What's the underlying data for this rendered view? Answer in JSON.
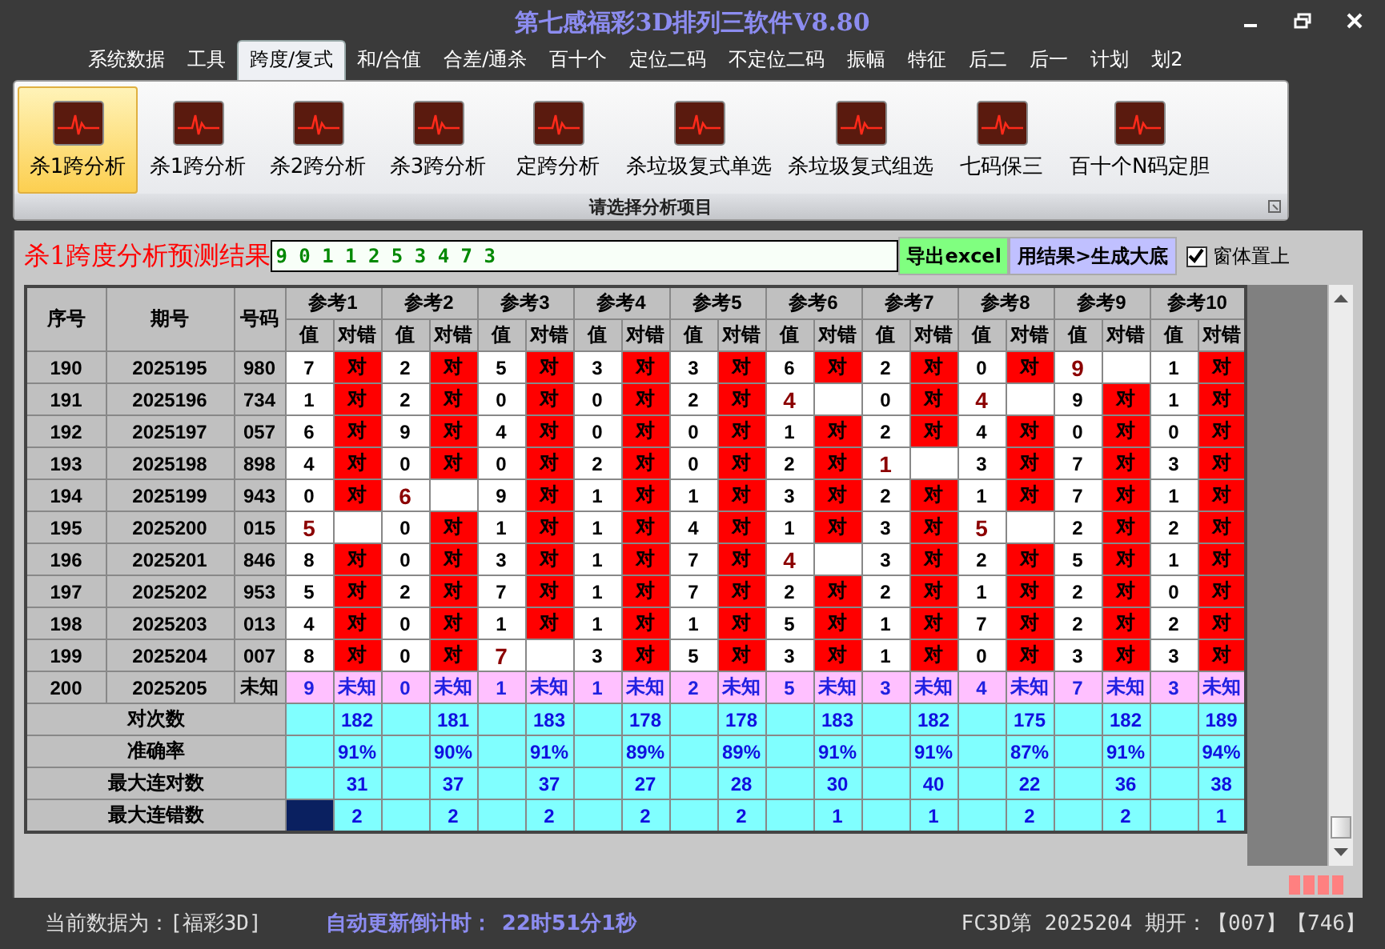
{
  "window": {
    "title": "第七感福彩3D排列三软件V8.80"
  },
  "menu_tabs": [
    {
      "label": "系统数据",
      "selected": false
    },
    {
      "label": "工具",
      "selected": false
    },
    {
      "label": "跨度/复式",
      "selected": true
    },
    {
      "label": "和/合值",
      "selected": false
    },
    {
      "label": "合差/通杀",
      "selected": false
    },
    {
      "label": "百十个",
      "selected": false
    },
    {
      "label": "定位二码",
      "selected": false
    },
    {
      "label": "不定位二码",
      "selected": false
    },
    {
      "label": "振幅",
      "selected": false
    },
    {
      "label": "特征",
      "selected": false
    },
    {
      "label": "后二",
      "selected": false
    },
    {
      "label": "后一",
      "selected": false
    },
    {
      "label": "计划",
      "selected": false
    },
    {
      "label": "划2",
      "selected": false
    }
  ],
  "ribbon": {
    "group_label": "请选择分析项目",
    "buttons": [
      {
        "label": "杀1跨分析",
        "selected": true
      },
      {
        "label": "杀1跨分析",
        "selected": false
      },
      {
        "label": "杀2跨分析",
        "selected": false
      },
      {
        "label": "杀3跨分析",
        "selected": false
      },
      {
        "label": "定跨分析",
        "selected": false
      },
      {
        "label": "杀垃圾复式单选",
        "selected": false
      },
      {
        "label": "杀垃圾复式组选",
        "selected": false
      },
      {
        "label": "七码保三",
        "selected": false
      },
      {
        "label": "百十个N码定胆",
        "selected": false
      }
    ]
  },
  "result_title": "杀1跨度分析预测结果",
  "result_value": "9 0 1 1 2 5 3 4 7 3",
  "export_button": "导出excel",
  "generate_button": "用结果>生成大底",
  "stay_on_top": {
    "label": "窗体置上",
    "checked": true
  },
  "table": {
    "columns": [
      "序号",
      "期号",
      "号码"
    ],
    "groups": [
      {
        "label": "参考1",
        "sub_columns": [
          "值",
          "对错"
        ]
      },
      {
        "label": "参考2",
        "sub_columns": [
          "值",
          "对错"
        ]
      },
      {
        "label": "参考3",
        "sub_columns": [
          "值",
          "对错"
        ]
      },
      {
        "label": "参考4",
        "sub_columns": [
          "值",
          "对错"
        ]
      },
      {
        "label": "参考5",
        "sub_columns": [
          "值",
          "对错"
        ]
      },
      {
        "label": "参考6",
        "sub_columns": [
          "值",
          "对错"
        ]
      },
      {
        "label": "参考7",
        "sub_columns": [
          "值",
          "对错"
        ]
      },
      {
        "label": "参考8",
        "sub_columns": [
          "值",
          "对错"
        ]
      },
      {
        "label": "参考9",
        "sub_columns": [
          "值",
          "对错"
        ]
      },
      {
        "label": "参考10",
        "sub_columns": [
          "值",
          "对错"
        ]
      }
    ],
    "rows": [
      {
        "kind": "history",
        "no": "190",
        "issue": "2025195",
        "code": "980",
        "cells": [
          {
            "v": "7",
            "ok": true,
            "mark": "对"
          },
          {
            "v": "2",
            "ok": true,
            "mark": "对"
          },
          {
            "v": "5",
            "ok": true,
            "mark": "对"
          },
          {
            "v": "3",
            "ok": true,
            "mark": "对"
          },
          {
            "v": "3",
            "ok": true,
            "mark": "对"
          },
          {
            "v": "6",
            "ok": true,
            "mark": "对"
          },
          {
            "v": "2",
            "ok": true,
            "mark": "对"
          },
          {
            "v": "0",
            "ok": true,
            "mark": "对"
          },
          {
            "v": "9",
            "ok": false
          },
          {
            "v": "1",
            "ok": true,
            "mark": "对"
          }
        ]
      },
      {
        "kind": "history",
        "no": "191",
        "issue": "2025196",
        "code": "734",
        "cells": [
          {
            "v": "1",
            "ok": true,
            "mark": "对"
          },
          {
            "v": "2",
            "ok": true,
            "mark": "对"
          },
          {
            "v": "0",
            "ok": true,
            "mark": "对"
          },
          {
            "v": "0",
            "ok": true,
            "mark": "对"
          },
          {
            "v": "2",
            "ok": true,
            "mark": "对"
          },
          {
            "v": "4",
            "ok": false
          },
          {
            "v": "0",
            "ok": true,
            "mark": "对"
          },
          {
            "v": "4",
            "ok": false
          },
          {
            "v": "9",
            "ok": true,
            "mark": "对"
          },
          {
            "v": "1",
            "ok": true,
            "mark": "对"
          }
        ]
      },
      {
        "kind": "history",
        "no": "192",
        "issue": "2025197",
        "code": "057",
        "cells": [
          {
            "v": "6",
            "ok": true,
            "mark": "对"
          },
          {
            "v": "9",
            "ok": true,
            "mark": "对"
          },
          {
            "v": "4",
            "ok": true,
            "mark": "对"
          },
          {
            "v": "0",
            "ok": true,
            "mark": "对"
          },
          {
            "v": "0",
            "ok": true,
            "mark": "对"
          },
          {
            "v": "1",
            "ok": true,
            "mark": "对"
          },
          {
            "v": "2",
            "ok": true,
            "mark": "对"
          },
          {
            "v": "4",
            "ok": true,
            "mark": "对"
          },
          {
            "v": "0",
            "ok": true,
            "mark": "对"
          },
          {
            "v": "0",
            "ok": true,
            "mark": "对"
          }
        ]
      },
      {
        "kind": "history",
        "no": "193",
        "issue": "2025198",
        "code": "898",
        "cells": [
          {
            "v": "4",
            "ok": true,
            "mark": "对"
          },
          {
            "v": "0",
            "ok": true,
            "mark": "对"
          },
          {
            "v": "0",
            "ok": true,
            "mark": "对"
          },
          {
            "v": "2",
            "ok": true,
            "mark": "对"
          },
          {
            "v": "0",
            "ok": true,
            "mark": "对"
          },
          {
            "v": "2",
            "ok": true,
            "mark": "对"
          },
          {
            "v": "1",
            "ok": false
          },
          {
            "v": "3",
            "ok": true,
            "mark": "对"
          },
          {
            "v": "7",
            "ok": true,
            "mark": "对"
          },
          {
            "v": "3",
            "ok": true,
            "mark": "对"
          }
        ]
      },
      {
        "kind": "history",
        "no": "194",
        "issue": "2025199",
        "code": "943",
        "cells": [
          {
            "v": "0",
            "ok": true,
            "mark": "对"
          },
          {
            "v": "6",
            "ok": false
          },
          {
            "v": "9",
            "ok": true,
            "mark": "对"
          },
          {
            "v": "1",
            "ok": true,
            "mark": "对"
          },
          {
            "v": "1",
            "ok": true,
            "mark": "对"
          },
          {
            "v": "3",
            "ok": true,
            "mark": "对"
          },
          {
            "v": "2",
            "ok": true,
            "mark": "对"
          },
          {
            "v": "1",
            "ok": true,
            "mark": "对"
          },
          {
            "v": "7",
            "ok": true,
            "mark": "对"
          },
          {
            "v": "1",
            "ok": true,
            "mark": "对"
          }
        ]
      },
      {
        "kind": "history",
        "no": "195",
        "issue": "2025200",
        "code": "015",
        "cells": [
          {
            "v": "5",
            "ok": false
          },
          {
            "v": "0",
            "ok": true,
            "mark": "对"
          },
          {
            "v": "1",
            "ok": true,
            "mark": "对"
          },
          {
            "v": "1",
            "ok": true,
            "mark": "对"
          },
          {
            "v": "4",
            "ok": true,
            "mark": "对"
          },
          {
            "v": "1",
            "ok": true,
            "mark": "对"
          },
          {
            "v": "3",
            "ok": true,
            "mark": "对"
          },
          {
            "v": "5",
            "ok": false
          },
          {
            "v": "2",
            "ok": true,
            "mark": "对"
          },
          {
            "v": "2",
            "ok": true,
            "mark": "对"
          }
        ]
      },
      {
        "kind": "history",
        "no": "196",
        "issue": "2025201",
        "code": "846",
        "cells": [
          {
            "v": "8",
            "ok": true,
            "mark": "对"
          },
          {
            "v": "0",
            "ok": true,
            "mark": "对"
          },
          {
            "v": "3",
            "ok": true,
            "mark": "对"
          },
          {
            "v": "1",
            "ok": true,
            "mark": "对"
          },
          {
            "v": "7",
            "ok": true,
            "mark": "对"
          },
          {
            "v": "4",
            "ok": false
          },
          {
            "v": "3",
            "ok": true,
            "mark": "对"
          },
          {
            "v": "2",
            "ok": true,
            "mark": "对"
          },
          {
            "v": "5",
            "ok": true,
            "mark": "对"
          },
          {
            "v": "1",
            "ok": true,
            "mark": "对"
          }
        ]
      },
      {
        "kind": "history",
        "no": "197",
        "issue": "2025202",
        "code": "953",
        "cells": [
          {
            "v": "5",
            "ok": true,
            "mark": "对"
          },
          {
            "v": "2",
            "ok": true,
            "mark": "对"
          },
          {
            "v": "7",
            "ok": true,
            "mark": "对"
          },
          {
            "v": "1",
            "ok": true,
            "mark": "对"
          },
          {
            "v": "7",
            "ok": true,
            "mark": "对"
          },
          {
            "v": "2",
            "ok": true,
            "mark": "对"
          },
          {
            "v": "2",
            "ok": true,
            "mark": "对"
          },
          {
            "v": "1",
            "ok": true,
            "mark": "对"
          },
          {
            "v": "2",
            "ok": true,
            "mark": "对"
          },
          {
            "v": "0",
            "ok": true,
            "mark": "对"
          }
        ]
      },
      {
        "kind": "history",
        "no": "198",
        "issue": "2025203",
        "code": "013",
        "cells": [
          {
            "v": "4",
            "ok": true,
            "mark": "对"
          },
          {
            "v": "0",
            "ok": true,
            "mark": "对"
          },
          {
            "v": "1",
            "ok": true,
            "mark": "对"
          },
          {
            "v": "1",
            "ok": true,
            "mark": "对"
          },
          {
            "v": "1",
            "ok": true,
            "mark": "对"
          },
          {
            "v": "5",
            "ok": true,
            "mark": "对"
          },
          {
            "v": "1",
            "ok": true,
            "mark": "对"
          },
          {
            "v": "7",
            "ok": true,
            "mark": "对"
          },
          {
            "v": "2",
            "ok": true,
            "mark": "对"
          },
          {
            "v": "2",
            "ok": true,
            "mark": "对"
          }
        ]
      },
      {
        "kind": "history",
        "no": "199",
        "issue": "2025204",
        "code": "007",
        "cells": [
          {
            "v": "8",
            "ok": true,
            "mark": "对"
          },
          {
            "v": "0",
            "ok": true,
            "mark": "对"
          },
          {
            "v": "7",
            "ok": false
          },
          {
            "v": "3",
            "ok": true,
            "mark": "对"
          },
          {
            "v": "5",
            "ok": true,
            "mark": "对"
          },
          {
            "v": "3",
            "ok": true,
            "mark": "对"
          },
          {
            "v": "1",
            "ok": true,
            "mark": "对"
          },
          {
            "v": "0",
            "ok": true,
            "mark": "对"
          },
          {
            "v": "3",
            "ok": true,
            "mark": "对"
          },
          {
            "v": "3",
            "ok": true,
            "mark": "对"
          }
        ]
      },
      {
        "kind": "pending",
        "no": "200",
        "issue": "2025205",
        "code": "未知",
        "cells": [
          {
            "v": "9",
            "mark": "未知"
          },
          {
            "v": "0",
            "mark": "未知"
          },
          {
            "v": "1",
            "mark": "未知"
          },
          {
            "v": "1",
            "mark": "未知"
          },
          {
            "v": "2",
            "mark": "未知"
          },
          {
            "v": "5",
            "mark": "未知"
          },
          {
            "v": "3",
            "mark": "未知"
          },
          {
            "v": "4",
            "mark": "未知"
          },
          {
            "v": "7",
            "mark": "未知"
          },
          {
            "v": "3",
            "mark": "未知"
          }
        ]
      }
    ],
    "summary": [
      {
        "label": "对次数",
        "focused": false,
        "values": [
          "182",
          "181",
          "183",
          "178",
          "178",
          "183",
          "182",
          "175",
          "182",
          "189"
        ]
      },
      {
        "label": "准确率",
        "focused": false,
        "values": [
          "91%",
          "90%",
          "91%",
          "89%",
          "89%",
          "91%",
          "91%",
          "87%",
          "91%",
          "94%"
        ]
      },
      {
        "label": "最大连对数",
        "focused": false,
        "values": [
          "31",
          "37",
          "37",
          "27",
          "28",
          "30",
          "40",
          "22",
          "36",
          "38"
        ]
      },
      {
        "label": "最大连错数",
        "focused": true,
        "values": [
          "2",
          "2",
          "2",
          "2",
          "2",
          "1",
          "1",
          "2",
          "2",
          "1"
        ]
      }
    ]
  },
  "status_bar": {
    "data_source": "当前数据为：[福彩3D]",
    "countdown_label": "自动更新倒计时：",
    "countdown_value": "22时51分1秒",
    "last_draw": "FC3D第 2025204 期开：【007】【746】"
  }
}
